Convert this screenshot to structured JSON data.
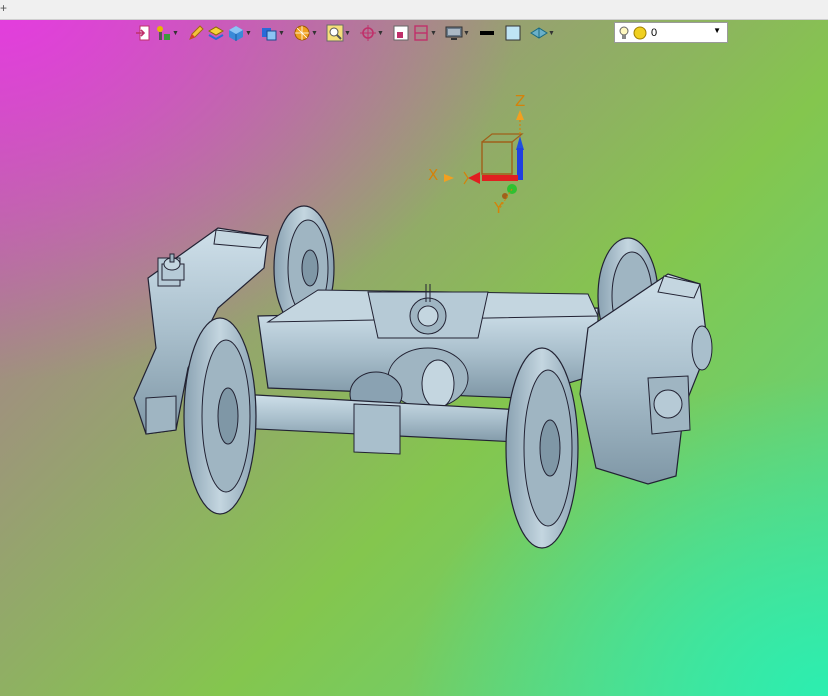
{
  "toolbar": {
    "tools": [
      {
        "name": "exit-view-icon",
        "dropdown": false
      },
      {
        "name": "brush-icon",
        "dropdown": true
      },
      {
        "name": "pencil-icon",
        "dropdown": false
      },
      {
        "name": "layer-stack-icon",
        "dropdown": false
      },
      {
        "name": "cube-icon",
        "dropdown": true
      },
      {
        "name": "view-cube-icon",
        "dropdown": true
      },
      {
        "name": "render-sphere-icon",
        "dropdown": true
      },
      {
        "name": "zoom-fit-icon",
        "dropdown": true
      },
      {
        "name": "pivot-icon",
        "dropdown": true
      },
      {
        "name": "section-icon",
        "dropdown": false
      },
      {
        "name": "clip-plane-icon",
        "dropdown": true
      },
      {
        "name": "display-icon",
        "dropdown": true
      },
      {
        "name": "line-color-icon",
        "dropdown": false
      },
      {
        "name": "fill-color-icon",
        "dropdown": false
      },
      {
        "name": "appearance-icon",
        "dropdown": true
      }
    ],
    "light_select": {
      "value": "0"
    }
  },
  "triad": {
    "x_label": "X",
    "y_label": "Y",
    "z_label": "Z"
  },
  "colors": {
    "axis_x": "#e02020",
    "axis_y": "#20c020",
    "axis_z": "#2040e0",
    "axis_label": "#d4820a",
    "model": "#a9bfcc"
  }
}
